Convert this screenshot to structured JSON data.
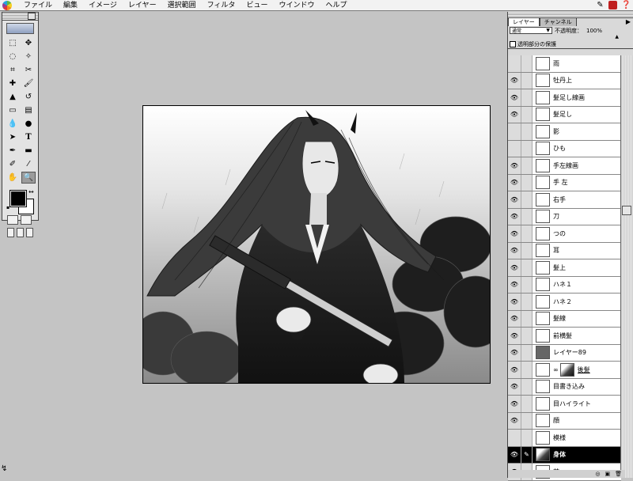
{
  "menubar": {
    "items": [
      "ファイル",
      "編集",
      "イメージ",
      "レイヤー",
      "選択範囲",
      "フィルタ",
      "ビュー",
      "ウインドウ",
      "ヘルプ"
    ]
  },
  "layers_palette": {
    "tabs": [
      "レイヤー",
      "チャンネル"
    ],
    "blend_mode": "通常",
    "opacity_label": "不透明度：",
    "opacity_value": "100%",
    "preserve_label": "透明部分の保護",
    "layers": [
      {
        "name": "雨",
        "visible": false
      },
      {
        "name": "牡丹上",
        "visible": true
      },
      {
        "name": "髪足し線画",
        "visible": true
      },
      {
        "name": "髪足し",
        "visible": true
      },
      {
        "name": "影",
        "visible": false
      },
      {
        "name": "ひも",
        "visible": false
      },
      {
        "name": "手左線画",
        "visible": true
      },
      {
        "name": "手 左",
        "visible": true
      },
      {
        "name": "右手",
        "visible": true
      },
      {
        "name": "刀",
        "visible": true
      },
      {
        "name": "つの",
        "visible": true
      },
      {
        "name": "耳",
        "visible": true
      },
      {
        "name": "髪上",
        "visible": true
      },
      {
        "name": "ハネ１",
        "visible": true
      },
      {
        "name": "ハネ２",
        "visible": true
      },
      {
        "name": "髪線",
        "visible": true
      },
      {
        "name": "前横髪",
        "visible": true
      },
      {
        "name": "レイヤー89",
        "visible": true
      },
      {
        "name": "後髪",
        "visible": true
      },
      {
        "name": "目書き込み",
        "visible": true
      },
      {
        "name": "目ハイライト",
        "visible": true
      },
      {
        "name": "顔",
        "visible": true
      },
      {
        "name": "模様",
        "visible": false
      },
      {
        "name": "身体",
        "visible": true,
        "active": true
      },
      {
        "name": "首",
        "visible": true
      }
    ]
  },
  "colors": {
    "foreground": "#000000",
    "background": "#ffffff"
  }
}
